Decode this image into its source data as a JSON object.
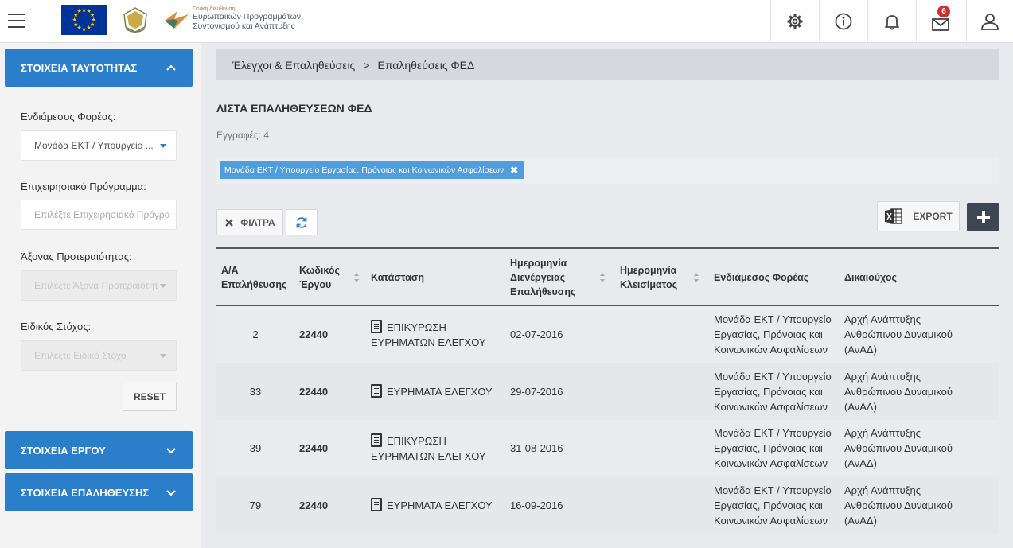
{
  "header": {
    "logo_text": [
      "Γενική Διεύθυνση",
      "Ευρωπαϊκών Προγραμμάτων,",
      "Συντονισμού και Ανάπτυξης"
    ],
    "mail_badge": "6",
    "icons": [
      "menu-icon",
      "gear-icon",
      "info-icon",
      "bell-icon",
      "mail-icon",
      "user-icon"
    ]
  },
  "sidebar": {
    "identity_panel": "ΣΤΟΙΧΕΙΑ ΤΑΥΤΟΤΗΤΑΣ",
    "fields": [
      {
        "label": "Ενδιάμεσος Φορέας:",
        "value": "Μονάδα ΕΚΤ / Υπουργείο ..."
      },
      {
        "label": "Επιχειρησιακό Πρόγραμμα:",
        "placeholder": "Επιλέξτε Επιχειρησιακό Πρόγρα"
      },
      {
        "label": "Άξονας Προτεραιότητας:",
        "placeholder": "Επιλέξτε Άξονα Προτεραιότητ"
      },
      {
        "label": "Ειδικός Στόχος:",
        "placeholder": "Επιλέξτε Ειδικό Στόχο"
      }
    ],
    "reset_label": "RESET",
    "project_panel": "ΣΤΟΙΧΕΙΑ ΕΡΓΟΥ",
    "verification_panel": "ΣΤΟΙΧΕΙΑ ΕΠΑΛΗΘΕΥΣΗΣ"
  },
  "breadcrumb": {
    "first": "Έλεγχοι & Επαληθεύσεις",
    "separator": ">",
    "second": "Επαληθεύσεις ΦΕΔ"
  },
  "main": {
    "title": "ΛΙΣΤΑ ΕΠΑΛΗΘΕΥΣΕΩΝ ΦΕΔ",
    "records": "Εγγραφές: 4",
    "filter_chip": "Μονάδα ΕΚΤ / Υπουργείο Εργασίας, Πρόνοιας και Κοινωνικών Ασφαλίσεων",
    "filters_button": "ΦΙΛΤΡΑ",
    "export_button": "EXPORT"
  },
  "table": {
    "columns": [
      [
        "Α/Α",
        "Επαλήθευσης"
      ],
      [
        "Κωδικός",
        "Έργου"
      ],
      [
        "Κατάσταση"
      ],
      [
        "Ημερομηνία",
        "Διενέργειας",
        "Επαλήθευσης"
      ],
      [
        "Ημερομηνία",
        "Κλεισίματος"
      ],
      [
        "Ενδιάμεσος Φορέας"
      ],
      [
        "Δικαιούχος"
      ]
    ],
    "rows": [
      {
        "aa": "2",
        "code": "22440",
        "status": [
          "ΕΠΙΚΥΡΩΣΗ",
          "ΕΥΡΗΜΑΤΩΝ ΕΛΕΓΧΟΥ"
        ],
        "date": "02-07-2016",
        "close": "",
        "body": [
          "Μονάδα ΕΚΤ / Υπουργείο",
          "Εργασίας, Πρόνοιας και",
          "Κοινωνικών Ασφαλίσεων"
        ],
        "beneficiary": [
          "Αρχή Ανάπτυξης",
          "Ανθρώπινου Δυναμικού",
          "(ΑνΑΔ)"
        ]
      },
      {
        "aa": "33",
        "code": "22440",
        "status": [
          "ΕΥΡΗΜΑΤΑ ΕΛΕΓΧΟΥ"
        ],
        "date": "29-07-2016",
        "close": "",
        "body": [
          "Μονάδα ΕΚΤ / Υπουργείο",
          "Εργασίας, Πρόνοιας και",
          "Κοινωνικών Ασφαλίσεων"
        ],
        "beneficiary": [
          "Αρχή Ανάπτυξης",
          "Ανθρώπινου Δυναμικού",
          "(ΑνΑΔ)"
        ]
      },
      {
        "aa": "39",
        "code": "22440",
        "status": [
          "ΕΠΙΚΥΡΩΣΗ",
          "ΕΥΡΗΜΑΤΩΝ ΕΛΕΓΧΟΥ"
        ],
        "date": "31-08-2016",
        "close": "",
        "body": [
          "Μονάδα ΕΚΤ / Υπουργείο",
          "Εργασίας, Πρόνοιας και",
          "Κοινωνικών Ασφαλίσεων"
        ],
        "beneficiary": [
          "Αρχή Ανάπτυξης",
          "Ανθρώπινου Δυναμικού",
          "(ΑνΑΔ)"
        ]
      },
      {
        "aa": "79",
        "code": "22440",
        "status": [
          "ΕΥΡΗΜΑΤΑ ΕΛΕΓΧΟΥ"
        ],
        "date": "16-09-2016",
        "close": "",
        "body": [
          "Μονάδα ΕΚΤ / Υπουργείο",
          "Εργασίας, Πρόνοιας και",
          "Κοινωνικών Ασφαλίσεων"
        ],
        "beneficiary": [
          "Αρχή Ανάπτυξης",
          "Ανθρώπινου Δυναμικού",
          "(ΑνΑΔ)"
        ]
      }
    ]
  },
  "colors": {
    "accent": "#2b7fca",
    "dark_button": "#3c4654",
    "chip": "#4f9ddc",
    "badge": "#d32f2f"
  }
}
